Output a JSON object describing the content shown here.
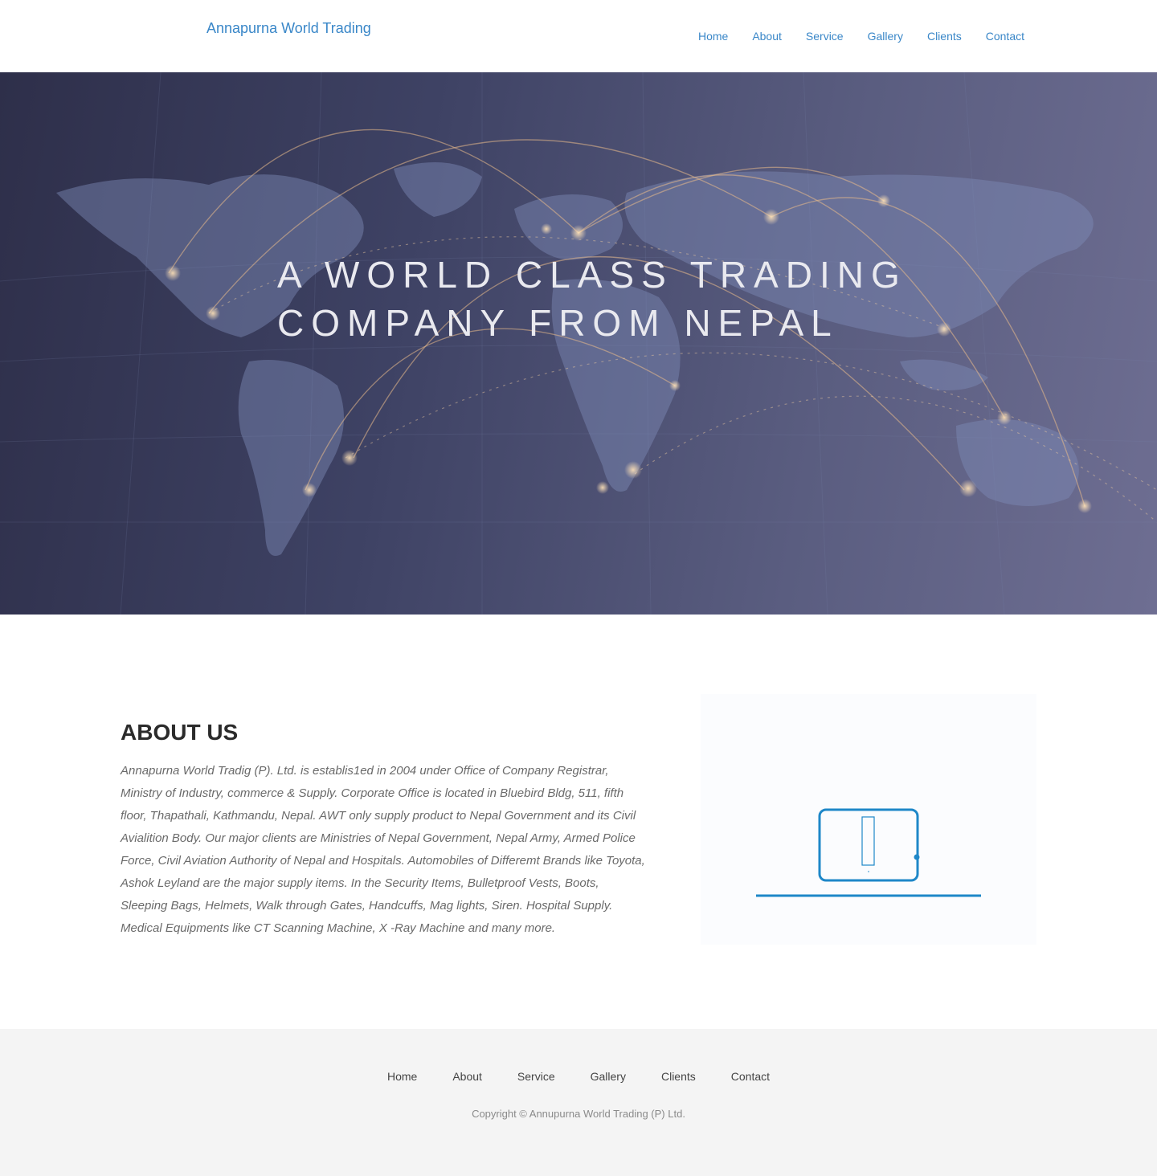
{
  "header": {
    "brand": "Annapurna World Trading",
    "nav": [
      "Home",
      "About",
      "Service",
      "Gallery",
      "Clients",
      "Contact"
    ]
  },
  "hero": {
    "title_line1": "A WORLD CLASS TRADING",
    "title_line2": "COMPANY FROM NEPAL"
  },
  "about": {
    "heading": "ABOUT US",
    "body": "Annapurna World Tradig (P). Ltd. is establis1ed in 2004 under Office of Company Registrar, Ministry of Industry, commerce & Supply. Corporate Office is located in Bluebird Bldg, 511, fifth floor, Thapathali, Kathmandu, Nepal. AWT only supply product to Nepal Government and its Civil Avialition Body. Our major clients are Ministries of Nepal Government, Nepal Army, Armed Police Force, Civil Aviation Authority of Nepal and Hospitals. Automobiles of Differemt Brands like Toyota, Ashok Leyland are the major supply items. In the Security Items, Bulletproof Vests, Boots, Sleeping Bags, Helmets, Walk through Gates, Handcuffs, Mag lights, Siren. Hospital Supply. Medical Equipments like CT Scanning Machine, X -Ray Machine and many more.",
    "media_icon": "tablet-icon"
  },
  "footer": {
    "nav": [
      "Home",
      "About",
      "Service",
      "Gallery",
      "Clients",
      "Contact"
    ],
    "copyright": "Copyright © Annupurna World Trading (P) Ltd."
  },
  "colors": {
    "accent": "#3a87c8",
    "icon_blue": "#1e87c8",
    "footer_bg": "#f4f4f4"
  }
}
